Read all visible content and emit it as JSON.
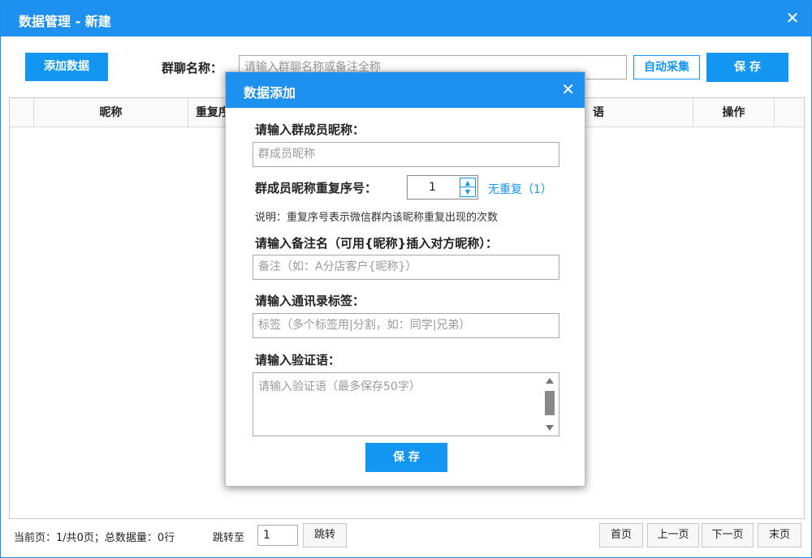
{
  "window": {
    "title": "数据管理 - 新建",
    "close": "✕"
  },
  "toolbar": {
    "add_data": "添加数据",
    "group_label": "群聊名称：",
    "group_placeholder": "请输入群聊名称或备注全称",
    "auto_collect": "自动采集",
    "save": "保 存"
  },
  "table": {
    "columns": [
      "昵称",
      "重复序",
      "语",
      "操作"
    ]
  },
  "footer": {
    "status": "当前页：1/共0页；总数据量：0行",
    "jump_label": "跳转至",
    "jump_value": "1",
    "jump_button": "跳转",
    "first": "首页",
    "prev": "上一页",
    "next": "下一页",
    "last": "末页"
  },
  "dialog": {
    "title": "数据添加",
    "close": "✕",
    "nickname_label": "请输入群成员昵称：",
    "nickname_placeholder": "群成员昵称",
    "repeat_label": "群成员昵称重复序号：",
    "repeat_value": "1",
    "repeat_hint": "无重复（1）",
    "note": "说明：重复序号表示微信群内该昵称重复出现的次数",
    "remark_label": "请输入备注名（可用{昵称}插入对方昵称）：",
    "remark_placeholder": "备注（如：A分店客户{昵称}）",
    "tag_label": "请输入通讯录标签：",
    "tag_placeholder": "标签（多个标签用|分割，如：同学|兄弟）",
    "verify_label": "请输入验证语：",
    "verify_placeholder": "请输入验证语（最多保存50字）",
    "save": "保 存"
  },
  "colors": {
    "accent": "#1e90f0",
    "button": "#1296f2"
  }
}
